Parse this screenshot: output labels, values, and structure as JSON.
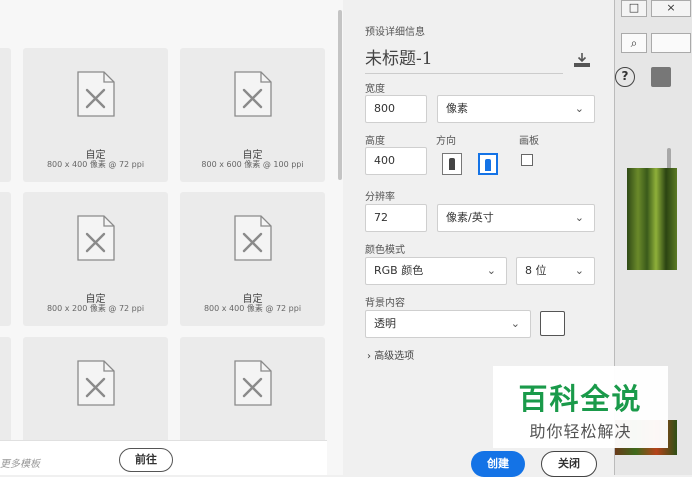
{
  "gallery": {
    "presets": [
      {
        "name": "自定",
        "size": "800 x 400 像素 @ 72 ppi"
      },
      {
        "name": "自定",
        "size": "800 x 600 像素 @ 100 ppi"
      },
      {
        "name": "自定",
        "size": "800 x 200 像素 @ 72 ppi"
      },
      {
        "name": "自定",
        "size": "800 x 400 像素 @ 72 ppi"
      }
    ],
    "more_templates": "更多模板",
    "goto_label": "前往"
  },
  "details": {
    "section_title": "预设详细信息",
    "doc_title": "未标题-1",
    "width_label": "宽度",
    "width_value": "800",
    "width_unit": "像素",
    "height_label": "高度",
    "height_value": "400",
    "orientation_label": "方向",
    "artboard_label": "画板",
    "resolution_label": "分辨率",
    "resolution_value": "72",
    "resolution_unit": "像素/英寸",
    "color_mode_label": "颜色模式",
    "color_mode_value": "RGB 颜色",
    "bit_depth_value": "8 位",
    "background_label": "背景内容",
    "background_value": "透明",
    "advanced_label": "高级选项",
    "create_label": "创建",
    "close_label": "关闭"
  },
  "bg_app": {
    "max_glyph": "□",
    "close_glyph": "×",
    "help_glyph": "?",
    "search_glyph": "⌕"
  },
  "watermark": {
    "title": "百科全说",
    "subtitle": "助你轻松解决"
  },
  "colors": {
    "accent": "#1473e6",
    "watermark_green": "#1a9a4a"
  }
}
